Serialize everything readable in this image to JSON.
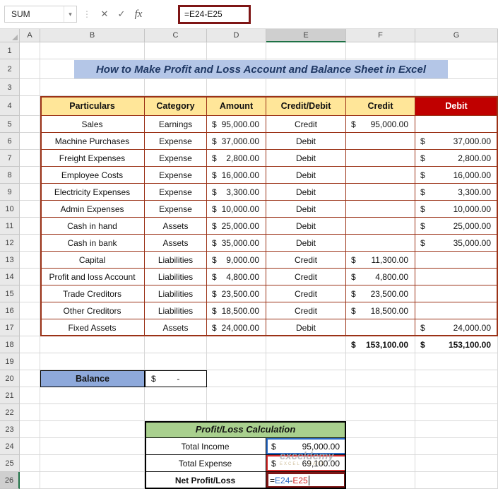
{
  "formula_bar": {
    "name_box": "SUM",
    "chevron": "▾",
    "dots": "⋮",
    "cancel": "✕",
    "enter": "✓",
    "fx": "fx",
    "formula": "=E24-E25"
  },
  "grid": {
    "col_letters": [
      "A",
      "B",
      "C",
      "D",
      "E",
      "F",
      "G"
    ],
    "row_numbers": [
      1,
      2,
      3,
      4,
      5,
      6,
      7,
      8,
      9,
      10,
      11,
      12,
      13,
      14,
      15,
      16,
      17,
      18,
      19,
      20,
      21,
      22,
      23,
      24,
      25,
      26
    ],
    "selected_col": "E",
    "selected_row": 26
  },
  "title": "How to Make Profit and Loss Account and Balance Sheet in Excel",
  "main_table": {
    "headers": [
      "Particulars",
      "Category",
      "Amount",
      "Credit/Debit",
      "Credit",
      "Debit"
    ],
    "rows": [
      {
        "particulars": "Sales",
        "category": "Earnings",
        "amount_cur": "$",
        "amount": "95,000.00",
        "cd": "Credit",
        "credit_cur": "$",
        "credit": "95,000.00",
        "debit_cur": "",
        "debit": ""
      },
      {
        "particulars": "Machine Purchases",
        "category": "Expense",
        "amount_cur": "$",
        "amount": "37,000.00",
        "cd": "Debit",
        "credit_cur": "",
        "credit": "",
        "debit_cur": "$",
        "debit": "37,000.00"
      },
      {
        "particulars": "Freight Expenses",
        "category": "Expense",
        "amount_cur": "$",
        "amount": "2,800.00",
        "cd": "Debit",
        "credit_cur": "",
        "credit": "",
        "debit_cur": "$",
        "debit": "2,800.00"
      },
      {
        "particulars": "Employee Costs",
        "category": "Expense",
        "amount_cur": "$",
        "amount": "16,000.00",
        "cd": "Debit",
        "credit_cur": "",
        "credit": "",
        "debit_cur": "$",
        "debit": "16,000.00"
      },
      {
        "particulars": "Electricity Expenses",
        "category": "Expense",
        "amount_cur": "$",
        "amount": "3,300.00",
        "cd": "Debit",
        "credit_cur": "",
        "credit": "",
        "debit_cur": "$",
        "debit": "3,300.00"
      },
      {
        "particulars": "Admin Expenses",
        "category": "Expense",
        "amount_cur": "$",
        "amount": "10,000.00",
        "cd": "Debit",
        "credit_cur": "",
        "credit": "",
        "debit_cur": "$",
        "debit": "10,000.00"
      },
      {
        "particulars": "Cash in hand",
        "category": "Assets",
        "amount_cur": "$",
        "amount": "25,000.00",
        "cd": "Debit",
        "credit_cur": "",
        "credit": "",
        "debit_cur": "$",
        "debit": "25,000.00"
      },
      {
        "particulars": "Cash in bank",
        "category": "Assets",
        "amount_cur": "$",
        "amount": "35,000.00",
        "cd": "Debit",
        "credit_cur": "",
        "credit": "",
        "debit_cur": "$",
        "debit": "35,000.00"
      },
      {
        "particulars": "Capital",
        "category": "Liabilities",
        "amount_cur": "$",
        "amount": "9,000.00",
        "cd": "Credit",
        "credit_cur": "$",
        "credit": "11,300.00",
        "debit_cur": "",
        "debit": ""
      },
      {
        "particulars": "Profit and loss Account",
        "category": "Liabilities",
        "amount_cur": "$",
        "amount": "4,800.00",
        "cd": "Credit",
        "credit_cur": "$",
        "credit": "4,800.00",
        "debit_cur": "",
        "debit": ""
      },
      {
        "particulars": "Trade Creditors",
        "category": "Liabilities",
        "amount_cur": "$",
        "amount": "23,500.00",
        "cd": "Credit",
        "credit_cur": "$",
        "credit": "23,500.00",
        "debit_cur": "",
        "debit": ""
      },
      {
        "particulars": "Other Creditors",
        "category": "Liabilities",
        "amount_cur": "$",
        "amount": "18,500.00",
        "cd": "Credit",
        "credit_cur": "$",
        "credit": "18,500.00",
        "debit_cur": "",
        "debit": ""
      },
      {
        "particulars": "Fixed Assets",
        "category": "Assets",
        "amount_cur": "$",
        "amount": "24,000.00",
        "cd": "Debit",
        "credit_cur": "",
        "credit": "",
        "debit_cur": "$",
        "debit": "24,000.00"
      }
    ]
  },
  "totals": {
    "credit_cur": "$",
    "credit": "153,100.00",
    "debit_cur": "$",
    "debit": "153,100.00"
  },
  "balance": {
    "label": "Balance",
    "cur": "$",
    "value": "-"
  },
  "pl_table": {
    "title": "Profit/Loss Calculation",
    "rows": [
      {
        "label": "Total Income",
        "cur": "$",
        "value": "95,000.00"
      },
      {
        "label": "Total Expense",
        "cur": "$",
        "value": "69,100.00"
      }
    ],
    "net_label": "Net Profit/Loss",
    "formula_parts": {
      "eq": "=",
      "ref1": "E24",
      "op": "-",
      "ref2": "E25"
    }
  },
  "watermark": {
    "brand": "exceldemy",
    "tagline": "EXCEL · DATA"
  },
  "colors": {
    "title_bg": "#B4C6E7",
    "title_text": "#1F3864",
    "table_header_bg": "#FFE699",
    "debit_header_bg": "#C00000",
    "table_border": "#9B3217",
    "balance_bg": "#8EA9DB",
    "pl_header_bg": "#A9D08E",
    "ref_blue": "#2B6BC6",
    "ref_red": "#D42A2A",
    "annotation_red": "#7E1515",
    "selection_green": "#1E7145"
  }
}
